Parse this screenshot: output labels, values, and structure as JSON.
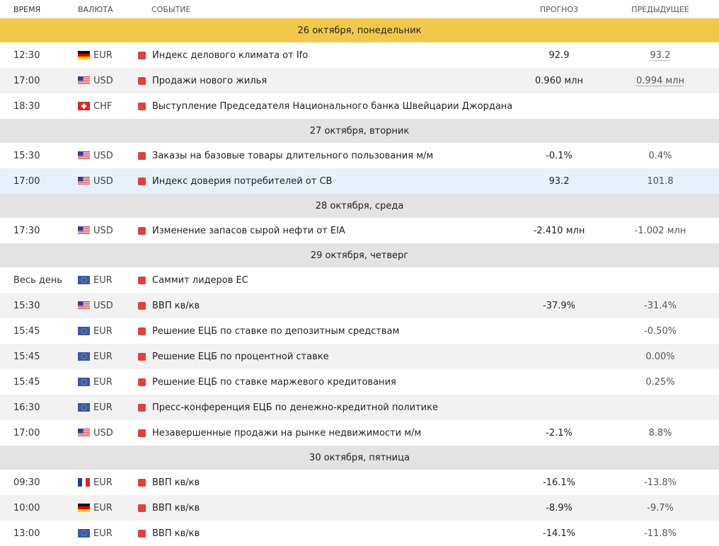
{
  "header": {
    "time": "ВРЕМЯ",
    "currency": "ВАЛЮТА",
    "event": "СОБЫТИЕ",
    "forecast": "ПРОГНОЗ",
    "previous": "ПРЕДЫДУЩЕЕ"
  },
  "days": [
    {
      "title": "26 октября, понедельник",
      "highlight": true,
      "events": [
        {
          "time": "12:30",
          "flag": "de",
          "currency": "EUR",
          "event": "Индекс делового климата от Ifo",
          "forecast": "92.9",
          "previous": "93.2",
          "prev_dotted": true
        },
        {
          "time": "17:00",
          "flag": "us",
          "currency": "USD",
          "event": "Продажи нового жилья",
          "forecast": "0.960 млн",
          "previous": "0.994 млн",
          "prev_dotted": true
        },
        {
          "time": "18:30",
          "flag": "ch",
          "currency": "CHF",
          "event": "Выступление Председателя Национального банка Швейцарии Джордана",
          "forecast": "",
          "previous": ""
        }
      ]
    },
    {
      "title": "27 октября, вторник",
      "events": [
        {
          "time": "15:30",
          "flag": "us",
          "currency": "USD",
          "event": "Заказы на базовые товары длительного пользования м/м",
          "forecast": "-0.1%",
          "previous": "0.4%"
        },
        {
          "time": "17:00",
          "flag": "us",
          "currency": "USD",
          "event": "Индекс доверия потребителей от CB",
          "forecast": "93.2",
          "previous": "101.8",
          "selected": true
        }
      ]
    },
    {
      "title": "28 октября, среда",
      "events": [
        {
          "time": "17:30",
          "flag": "us",
          "currency": "USD",
          "event": "Изменение запасов сырой нефти от EIA",
          "forecast": "-2.410 млн",
          "previous": "-1.002 млн"
        }
      ]
    },
    {
      "title": "29 октября, четверг",
      "events": [
        {
          "time": "Весь день",
          "flag": "eu",
          "currency": "EUR",
          "event": "Саммит лидеров ЕС",
          "forecast": "",
          "previous": ""
        },
        {
          "time": "15:30",
          "flag": "us",
          "currency": "USD",
          "event": "ВВП кв/кв",
          "forecast": "-37.9%",
          "previous": "-31.4%"
        },
        {
          "time": "15:45",
          "flag": "eu",
          "currency": "EUR",
          "event": "Решение ЕЦБ по ставке по депозитным средствам",
          "forecast": "",
          "previous": "-0.50%"
        },
        {
          "time": "15:45",
          "flag": "eu",
          "currency": "EUR",
          "event": "Решение ЕЦБ по процентной ставке",
          "forecast": "",
          "previous": "0.00%"
        },
        {
          "time": "15:45",
          "flag": "eu",
          "currency": "EUR",
          "event": "Решение ЕЦБ по ставке маржевого кредитования",
          "forecast": "",
          "previous": "0.25%"
        },
        {
          "time": "16:30",
          "flag": "eu",
          "currency": "EUR",
          "event": "Пресс-конференция ЕЦБ по денежно-кредитной политике",
          "forecast": "",
          "previous": ""
        },
        {
          "time": "17:00",
          "flag": "us",
          "currency": "USD",
          "event": "Незавершенные продажи на рынке недвижимости м/м",
          "forecast": "-2.1%",
          "previous": "8.8%"
        }
      ]
    },
    {
      "title": "30 октября, пятница",
      "events": [
        {
          "time": "09:30",
          "flag": "fr",
          "currency": "EUR",
          "event": "ВВП кв/кв",
          "forecast": "-16.1%",
          "previous": "-13.8%"
        },
        {
          "time": "10:00",
          "flag": "de",
          "currency": "EUR",
          "event": "ВВП кв/кв",
          "forecast": "-8.9%",
          "previous": "-9.7%"
        },
        {
          "time": "13:00",
          "flag": "eu",
          "currency": "EUR",
          "event": "ВВП кв/кв",
          "forecast": "-14.1%",
          "previous": "-11.8%"
        }
      ]
    }
  ],
  "colors": {
    "today_band": "#f2c84b",
    "day_band": "#e3e3e3",
    "importance_high": "#e04040",
    "row_alt": "#f2f2f2",
    "row_selected": "#e6f1fb"
  }
}
